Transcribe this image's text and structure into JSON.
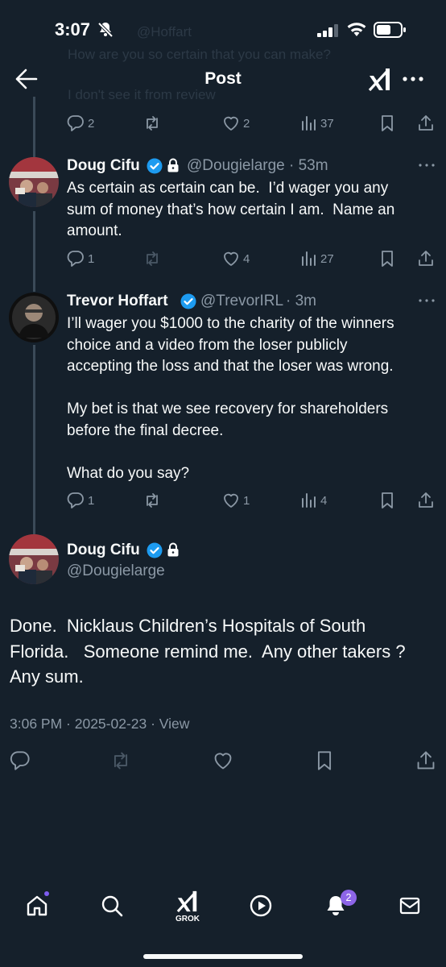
{
  "status_bar": {
    "time": "3:07"
  },
  "header": {
    "title": "Post",
    "ghost_lines": [
      "@Hoffart",
      "How are you so certain that you can make?",
      "I don't see it from review"
    ]
  },
  "parent_tweet_actions": {
    "reply": "2",
    "like": "2",
    "views": "37"
  },
  "tweets": [
    {
      "name": "Doug Cifu",
      "handle": "@Dougielarge",
      "time": "· 53m",
      "text": "As certain as certain can be.  I’d wager you any\nsum of money that’s how certain I am.  Name an\namount.",
      "reply": "1",
      "like": "4",
      "views": "27"
    },
    {
      "name": "Trevor Hoffart",
      "handle": "@TrevorIRL",
      "time": "· 3m",
      "text": "I’ll wager you $1000 to the charity of the winners\nchoice and a video from the loser publicly\naccepting the loss and that the loser was wrong.\n\nMy bet is that we see recovery for shareholders\nbefore the final decree.\n\nWhat do you say?",
      "reply": "1",
      "like": "1",
      "views": "4"
    }
  ],
  "main_tweet": {
    "name": "Doug Cifu",
    "handle": "@Dougielarge",
    "text": "Done.  Nicklaus Children’s Hospitals of South\nFlorida.   Someone remind me.  Any other takers ?\nAny sum.",
    "meta": "3:06 PM · 2025-02-23 · View"
  },
  "bottom_nav": {
    "grok_label": "GROK",
    "notifications_count": "2"
  },
  "colors": {
    "background": "#15202b",
    "text": "#f7f9f9",
    "muted": "#8b98a5",
    "verified": "#1d9bf0",
    "badge": "#8d65e8"
  }
}
